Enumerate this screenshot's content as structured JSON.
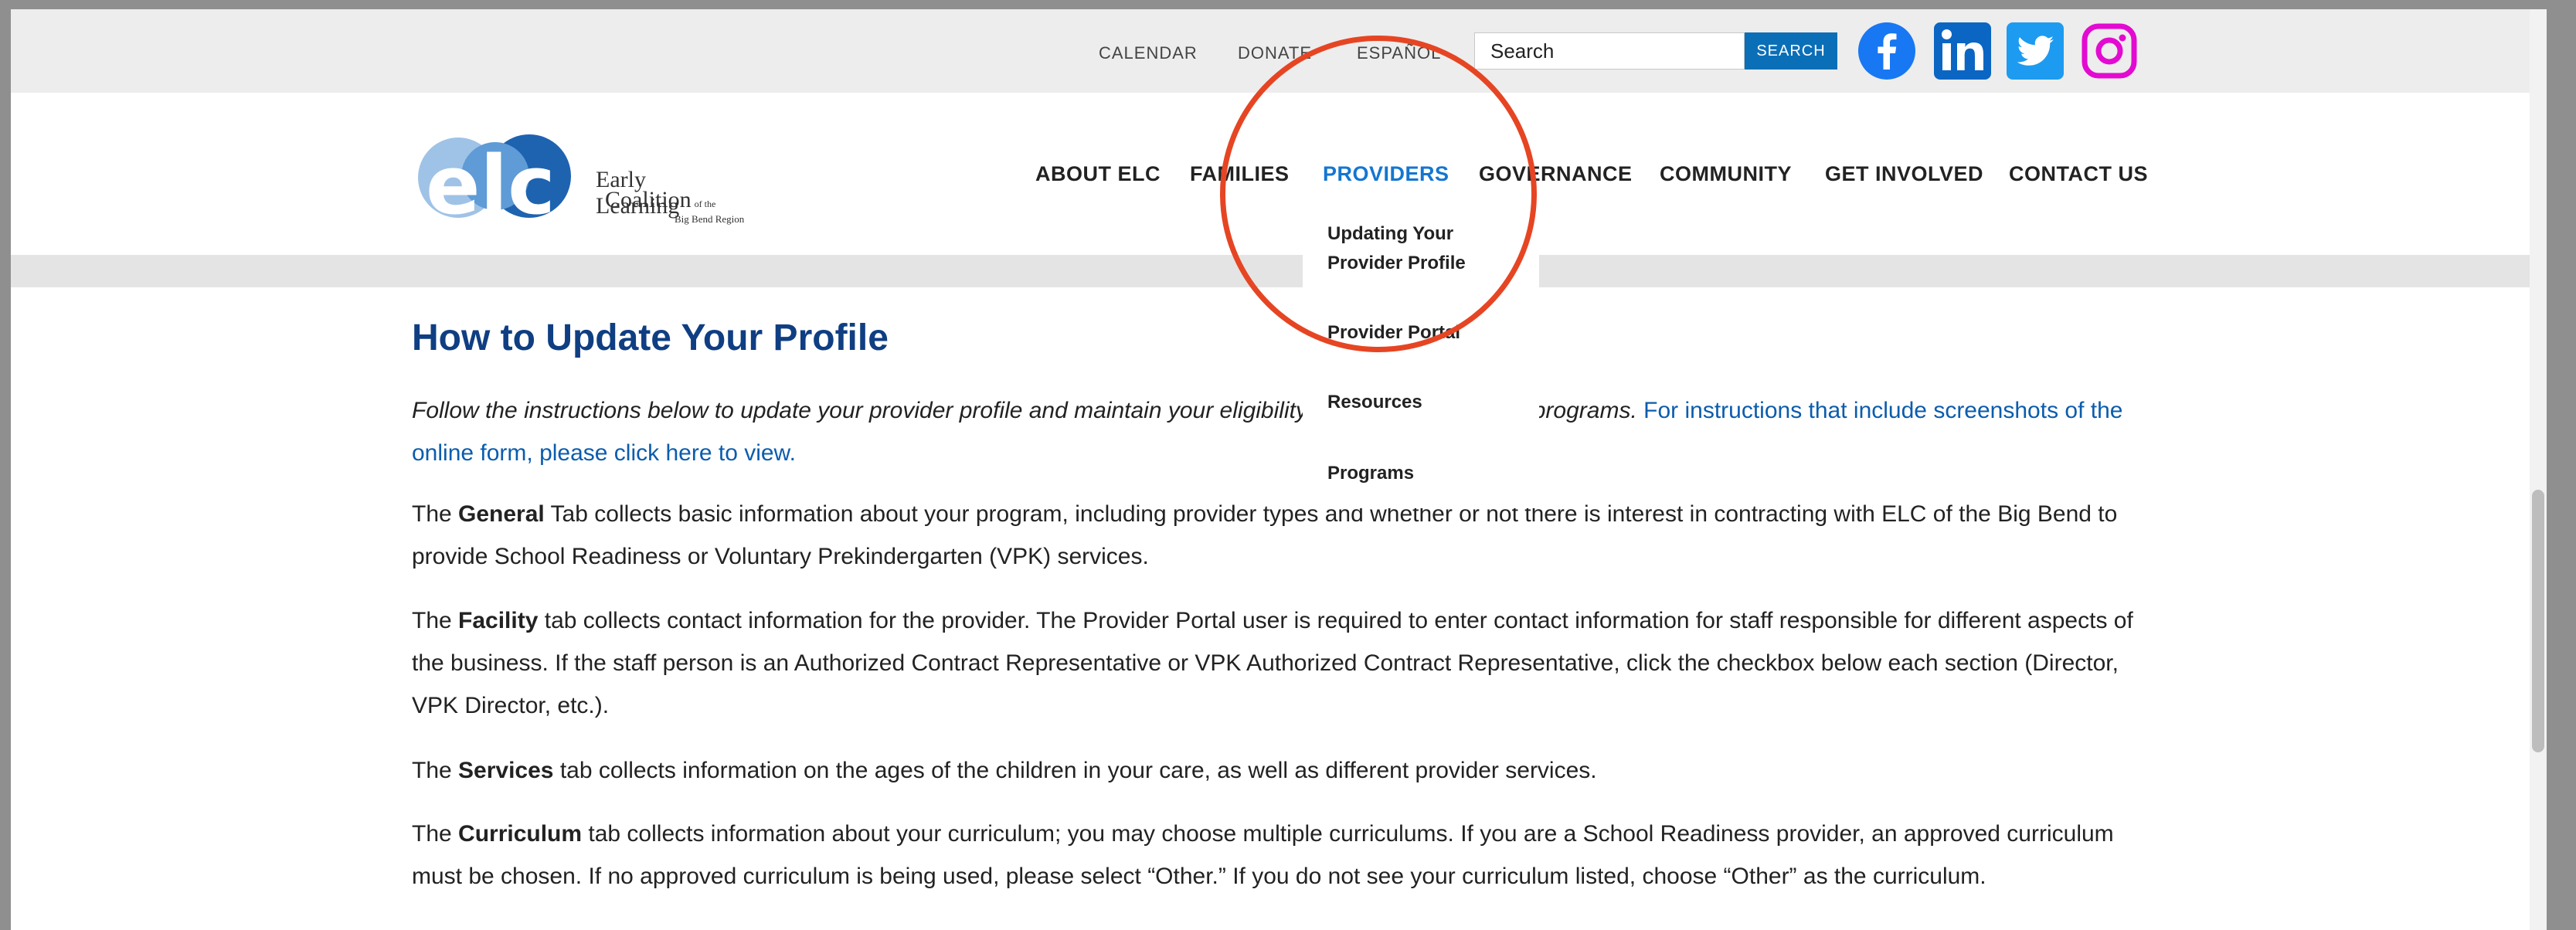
{
  "topbar": {
    "links": [
      "CALENDAR",
      "DONATE",
      "ESPAÑOL"
    ],
    "search": {
      "value": "",
      "placeholder": "Search",
      "button_label": "SEARCH"
    },
    "social": [
      "facebook-icon",
      "linkedin-icon",
      "twitter-icon",
      "instagram-icon"
    ]
  },
  "logo": {
    "mark": "elc",
    "line1": "Early Learning",
    "line2": "Coalition",
    "line2_small": "of the",
    "line3": "Big Bend Region"
  },
  "nav": {
    "items": [
      "ABOUT ELC",
      "FAMILIES",
      "PROVIDERS",
      "GOVERNANCE",
      "COMMUNITY",
      "GET INVOLVED",
      "CONTACT US"
    ],
    "active": "PROVIDERS"
  },
  "dropdown": {
    "items": [
      "Updating Your Provider Profile",
      "Provider Portal",
      "Resources",
      "Programs"
    ]
  },
  "content": {
    "title": "How to Update Your Profile",
    "intro": "Follow the instructions below to update your provider profile and maintain your eligibility for our contracts and programs. ",
    "intro_link": "For instructions that include screenshots of the online form, please click here to view.",
    "paragraphs": [
      {
        "pre": "The ",
        "bold": "General",
        "post": " Tab collects basic information about your program, including provider types and whether or not there is interest in contracting with ELC of the Big Bend to provide School Readiness or Voluntary Prekindergarten (VPK) services."
      },
      {
        "pre": "The ",
        "bold": "Facility",
        "post": " tab collects contact information for the provider. The Provider Portal user is required to enter contact information for staff responsible for different aspects of the business. If the staff person is an Authorized Contract Representative or VPK Authorized Contract Representative, click the checkbox below each section (Director, VPK Director, etc.)."
      },
      {
        "pre": "The ",
        "bold": "Services",
        "post": " tab collects information on the ages of the children in your care, as well as different provider services."
      },
      {
        "pre": "The ",
        "bold": "Curriculum",
        "post": " tab collects information about your curriculum; you may choose multiple curriculums. If you are a School Readiness provider, an approved curriculum must be chosen. If no approved curriculum is being used, please select “Other.” If you do not see your curriculum listed, choose “Other” as the curriculum."
      }
    ]
  },
  "colors": {
    "brand_blue": "#0f3e82",
    "link_blue": "#0b5cad",
    "search_button": "#0b6fb8",
    "annotation_circle": "#e64523",
    "instagram": "#e30ad1"
  }
}
